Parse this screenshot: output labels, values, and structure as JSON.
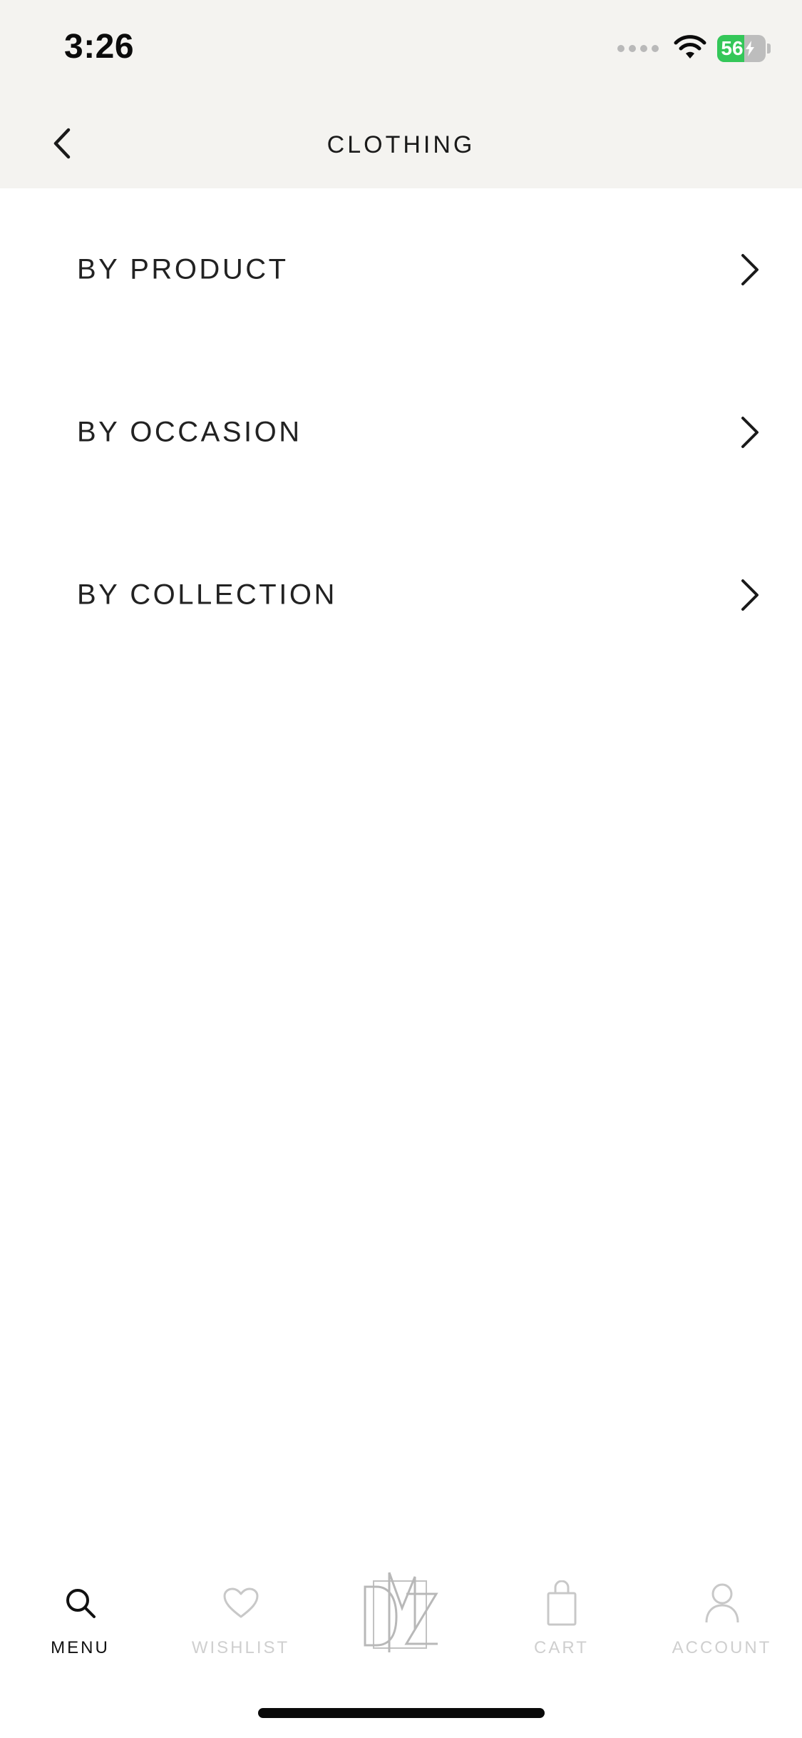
{
  "status_bar": {
    "time": "3:26",
    "battery_level": "56",
    "battery_fraction": 0.56,
    "icons": [
      "cellular-signal-icon",
      "wifi-icon",
      "battery-charging-icon"
    ]
  },
  "header": {
    "title": "CLOTHING",
    "back_icon": "chevron-left-icon"
  },
  "menu": {
    "items": [
      {
        "label": "BY PRODUCT",
        "icon": "chevron-right-icon"
      },
      {
        "label": "BY OCCASION",
        "icon": "chevron-right-icon"
      },
      {
        "label": "BY COLLECTION",
        "icon": "chevron-right-icon"
      }
    ]
  },
  "tabbar": {
    "tabs": [
      {
        "label": "MENU",
        "icon": "search-icon",
        "active": true
      },
      {
        "label": "WISHLIST",
        "icon": "heart-icon",
        "active": false
      },
      {
        "label": "",
        "icon": "brand-logo-icon",
        "active": false
      },
      {
        "label": "CART",
        "icon": "shopping-bag-icon",
        "active": false
      },
      {
        "label": "ACCOUNT",
        "icon": "user-icon",
        "active": false
      }
    ]
  },
  "colors": {
    "header_background": "#f4f3f0",
    "text_primary": "#1f1f1f",
    "tab_inactive": "#cfcfcf",
    "battery_green": "#34c759"
  }
}
